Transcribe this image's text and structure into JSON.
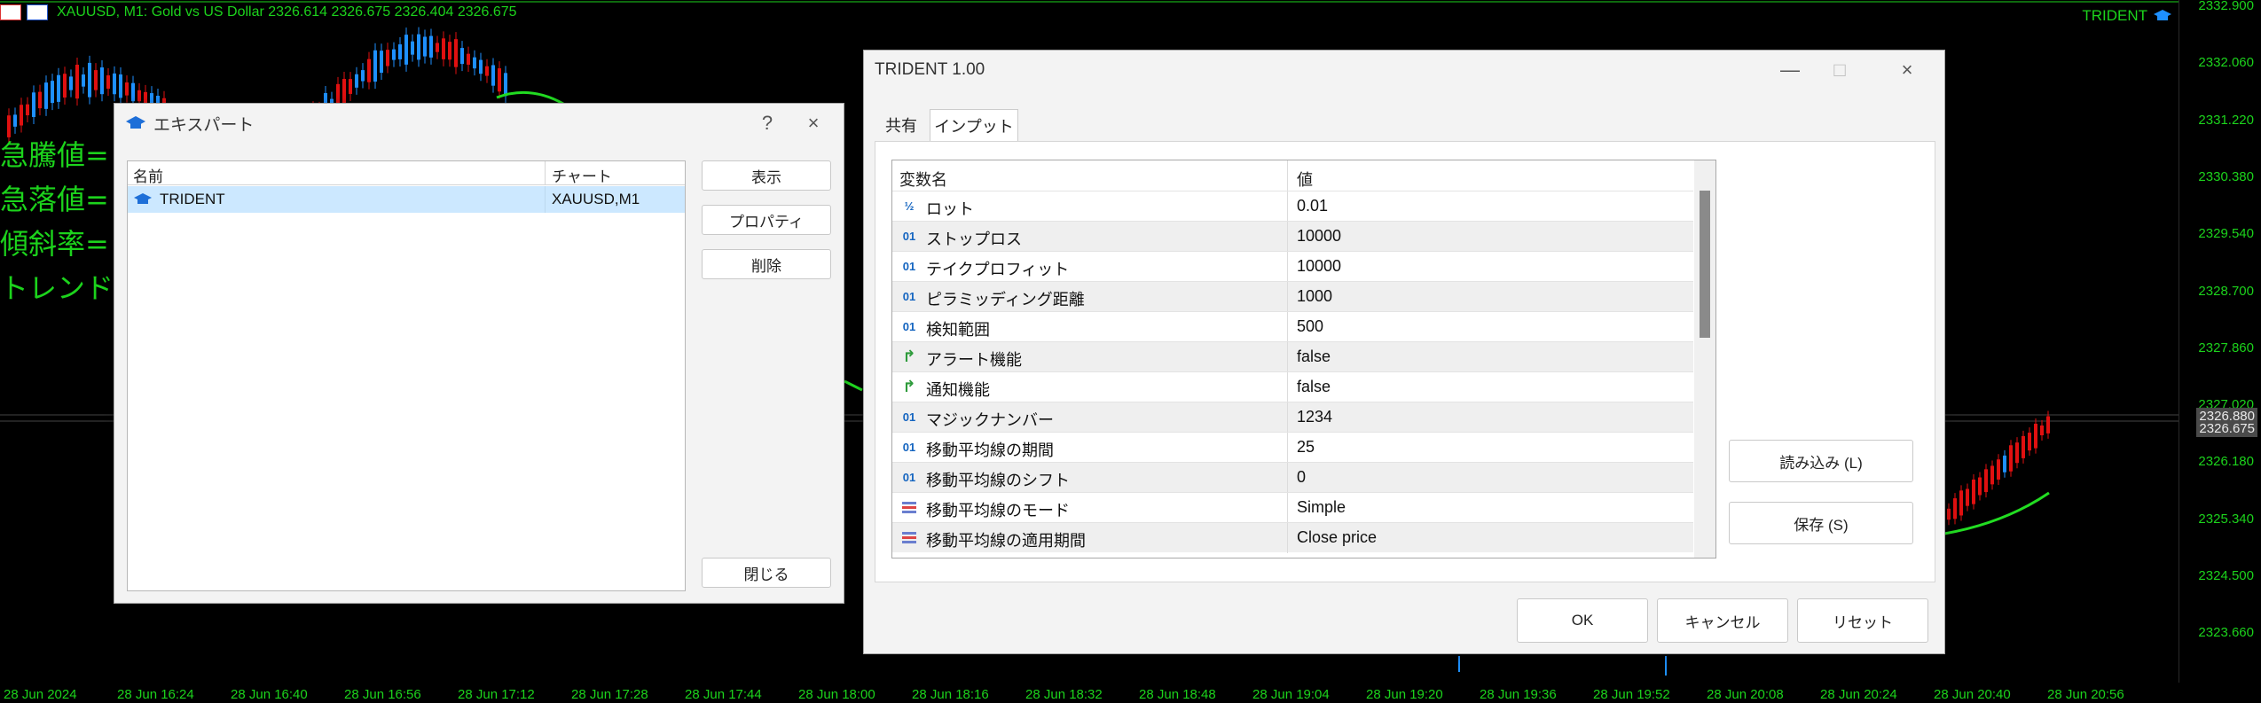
{
  "chart": {
    "title": "XAUUSD, M1:  Gold vs US Dollar  2326.614 2326.675 2326.404 2326.675",
    "ea_name": "TRIDENT",
    "overlay_lines": [
      "急騰値=",
      "急落値=",
      "傾斜率=",
      "トレンド判"
    ],
    "price_labels": [
      "2332.900",
      "2332.060",
      "2331.220",
      "2330.380",
      "2329.540",
      "2328.700",
      "2327.860",
      "2327.020",
      "2326.180",
      "2325.340",
      "2324.500",
      "2323.660"
    ],
    "price_tags": [
      "2326.880",
      "2326.675"
    ],
    "time_labels": [
      "28 Jun 2024",
      "28 Jun 16:24",
      "28 Jun 16:40",
      "28 Jun 16:56",
      "28 Jun 17:12",
      "28 Jun 17:28",
      "28 Jun 17:44",
      "28 Jun 18:00",
      "28 Jun 18:16",
      "28 Jun 18:32",
      "28 Jun 18:48",
      "28 Jun 19:04",
      "28 Jun 19:20",
      "28 Jun 19:36",
      "28 Jun 19:52",
      "28 Jun 20:08",
      "28 Jun 20:24",
      "28 Jun 20:40",
      "28 Jun 20:56"
    ],
    "colors": {
      "background": "#000000",
      "scale_text": "#1cd31c",
      "bull": "#e01010",
      "bear": "#1e90ff",
      "ma": "#22dd22"
    }
  },
  "expert_dialog": {
    "title": "エキスパート",
    "help": "?",
    "close": "×",
    "columns": [
      "名前",
      "チャート"
    ],
    "rows": [
      {
        "name": "TRIDENT",
        "chart": "XAUUSD,M1"
      }
    ],
    "buttons": {
      "show": "表示",
      "properties": "プロパティ",
      "delete": "削除",
      "close": "閉じる"
    }
  },
  "trident_dialog": {
    "title": "TRIDENT 1.00",
    "minimize": "—",
    "maximize": "□",
    "close": "×",
    "tabs": [
      "共有",
      "インプット"
    ],
    "active_tab": "インプット",
    "columns": [
      "変数名",
      "値"
    ],
    "params": [
      {
        "icon": "half",
        "name": "ロット",
        "value": "0.01"
      },
      {
        "icon": "int",
        "name": "ストップロス",
        "value": "10000"
      },
      {
        "icon": "int",
        "name": "テイクプロフィット",
        "value": "10000"
      },
      {
        "icon": "int",
        "name": "ピラミッディング距離",
        "value": "1000"
      },
      {
        "icon": "int",
        "name": "検知範囲",
        "value": "500"
      },
      {
        "icon": "bool",
        "name": "アラート機能",
        "value": "false"
      },
      {
        "icon": "bool",
        "name": "通知機能",
        "value": "false"
      },
      {
        "icon": "int",
        "name": "マジックナンバー",
        "value": "1234"
      },
      {
        "icon": "int",
        "name": "移動平均線の期間",
        "value": "25"
      },
      {
        "icon": "int",
        "name": "移動平均線のシフト",
        "value": "0"
      },
      {
        "icon": "enum",
        "name": "移動平均線のモード",
        "value": "Simple"
      },
      {
        "icon": "enum",
        "name": "移動平均線の適用期間",
        "value": "Close price"
      }
    ],
    "icon_glyphs": {
      "half": "½",
      "int": "01",
      "bool": "↱"
    },
    "side_buttons": {
      "load": "読み込み (L)",
      "save": "保存 (S)"
    },
    "footer_buttons": {
      "ok": "OK",
      "cancel": "キャンセル",
      "reset": "リセット"
    }
  }
}
